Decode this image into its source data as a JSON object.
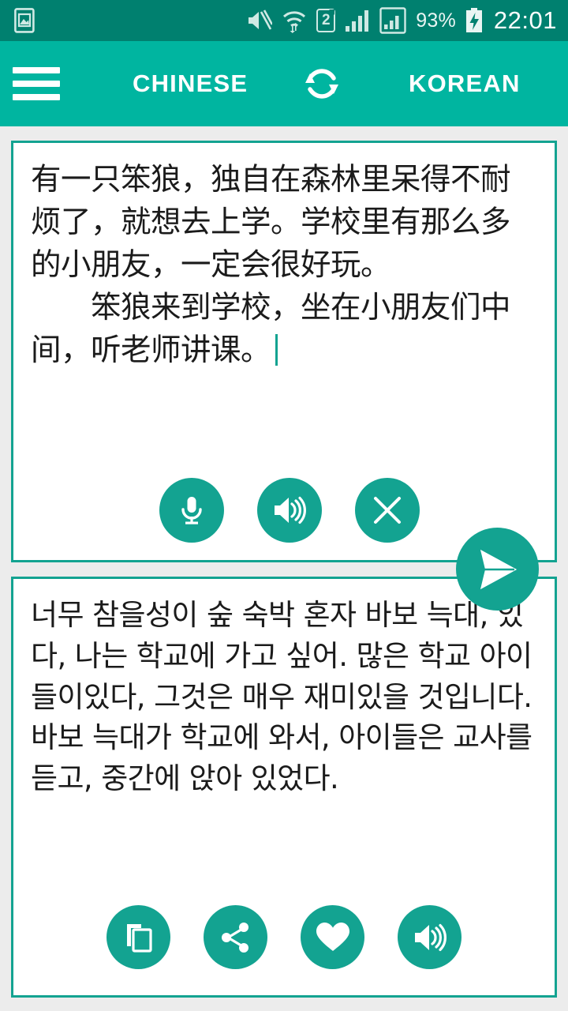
{
  "status_bar": {
    "background_color": "#00806f",
    "gallery_icon": "gallery-icon",
    "mute_icon": "volume-muted-icon",
    "wifi_icon": "wifi-transfer-icon",
    "sim_label": "2",
    "signal_icon_1": "signal-bars-icon",
    "signal_icon_2": "signal-bars-boxed-icon",
    "battery_percent": "93%",
    "battery_icon": "battery-charging-icon",
    "clock": "22:01"
  },
  "app_bar": {
    "background_color": "#00b5a0",
    "menu_icon": "hamburger-menu-icon",
    "source_language": "CHINESE",
    "swap_icon": "swap-languages-icon",
    "target_language": "KOREAN"
  },
  "source_card": {
    "border_color": "#13a391",
    "text": "有一只笨狼，独自在森林里呆得不耐烦了，就想去上学。学校里有那么多的小朋友，一定会很好玩。\n　　笨狼来到学校，坐在小朋友们中间，听老师讲课。",
    "actions": [
      {
        "name": "microphone-button",
        "icon": "microphone-icon"
      },
      {
        "name": "speak-source-button",
        "icon": "speaker-icon"
      },
      {
        "name": "clear-text-button",
        "icon": "close-icon"
      }
    ]
  },
  "send_button": {
    "name": "translate-send-button",
    "icon": "send-icon",
    "color": "#13a391"
  },
  "target_card": {
    "border_color": "#13a391",
    "text": "너무 참을성이 숲 숙박 혼자 바보 늑대, 있다, 나는 학교에 가고 싶어. 많은 학교 아이들이있다, 그것은 매우 재미있을 것입니다.\n바보 늑대가 학교에 와서, 아이들은 교사를 듣고, 중간에 앉아 있었다.",
    "actions": [
      {
        "name": "copy-button",
        "icon": "copy-icon"
      },
      {
        "name": "share-button",
        "icon": "share-icon"
      },
      {
        "name": "favorite-button",
        "icon": "heart-icon"
      },
      {
        "name": "speak-translation-button",
        "icon": "speaker-icon"
      }
    ]
  }
}
